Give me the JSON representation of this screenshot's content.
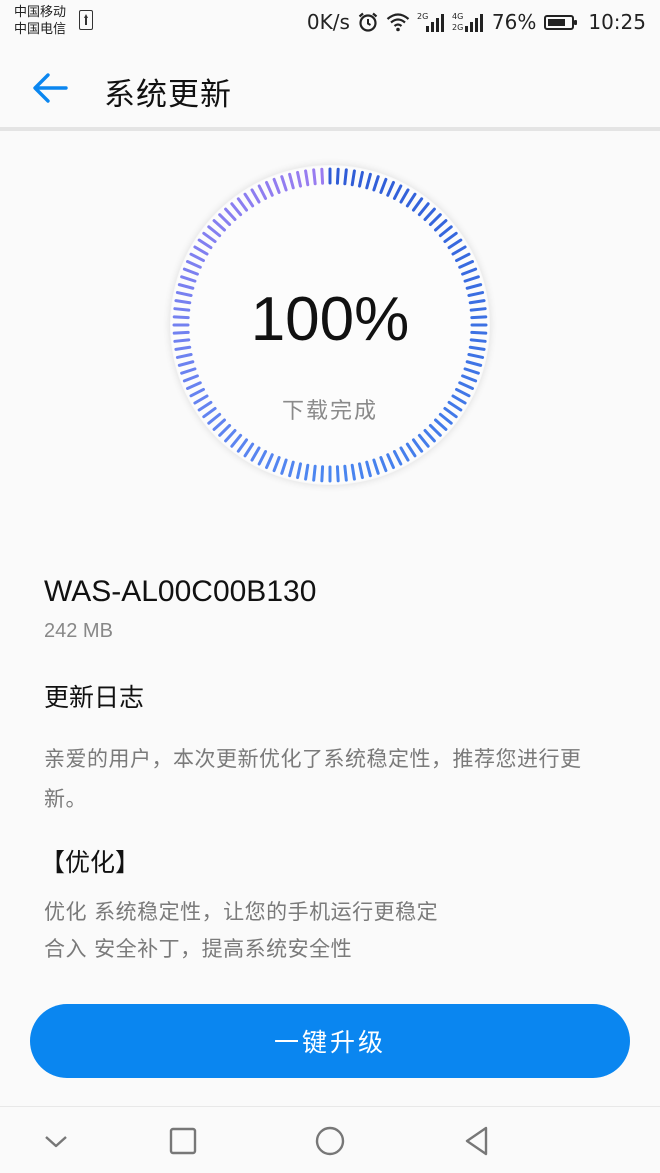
{
  "status_bar": {
    "carrier_1": "中国移动",
    "carrier_2": "中国电信",
    "net_speed": "0K/s",
    "signal_1_tag": "2G",
    "signal_2_tag_a": "4G",
    "signal_2_tag_b": "2G",
    "battery": "76%",
    "battery_level": 0.76,
    "time": "10:25",
    "icons": [
      "upload-icon",
      "alarm-icon",
      "wifi-icon",
      "signal-icon",
      "signal-icon",
      "battery-icon"
    ]
  },
  "header": {
    "title": "系统更新",
    "back_icon": "arrow-left-icon"
  },
  "progress": {
    "percent_text": "100%",
    "percent_value": 1.0,
    "status": "下载完成",
    "colors": {
      "start": "#2f5bd6",
      "mid": "#4a86f0",
      "end": "#9b7cf0"
    }
  },
  "package": {
    "version": "WAS-AL00C00B130",
    "size": "242 MB"
  },
  "changelog": {
    "title": "更新日志",
    "intro": "亲爱的用户，本次更新优化了系统稳定性，推荐您进行更新。",
    "section_title": "【优化】",
    "items": [
      "优化 系统稳定性，让您的手机运行更稳定",
      "合入 安全补丁，提高系统安全性"
    ]
  },
  "action": {
    "upgrade_label": "一键升级",
    "accent": "#0a86f0"
  },
  "navbar": {
    "icons": [
      "chevron-down-icon",
      "square-icon",
      "circle-icon",
      "triangle-back-icon"
    ]
  }
}
